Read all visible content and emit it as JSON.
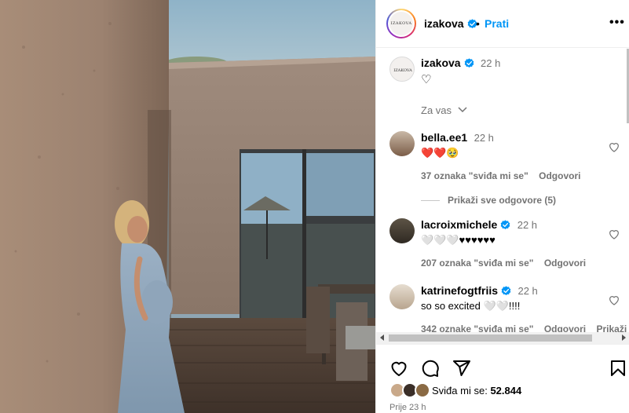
{
  "header": {
    "username": "izakova",
    "avatar_text": "IZAKOVA",
    "follow_label": "Prati",
    "more_label": "•••"
  },
  "caption": {
    "username": "izakova",
    "time": "22 h",
    "text": "♡"
  },
  "for_you_label": "Za vas",
  "comments": [
    {
      "username": "bella.ee1",
      "time": "22 h",
      "text": "❤️❤️🥹",
      "likes": "37 oznaka \"sviđa mi se\"",
      "reply": "Odgovori",
      "verified": false
    },
    {
      "username": "lacroixmichele",
      "time": "22 h",
      "text": "🤍🤍🤍♥♥♥♥♥♥",
      "likes": "207 oznaka \"sviđa mi se\"",
      "reply": "Odgovori",
      "verified": true
    },
    {
      "username": "katrinefogtfriis",
      "time": "22 h",
      "text": "so so excited 🤍🤍!!!!",
      "likes": "342 oznake \"sviđa mi se\"",
      "reply": "Odgovori",
      "extra": "Prikaži pr",
      "verified": true
    }
  ],
  "view_replies": "Prikaži sve odgovore (5)",
  "actions": {
    "likes_prefix": "Sviđa mi se:",
    "likes_count": "52.844",
    "posted": "Prije 23 h"
  },
  "colors": {
    "link": "#0095f6",
    "verified": "#0095f6",
    "muted": "#737373",
    "heart": "#ed4956"
  },
  "icons": [
    "verified-badge-icon",
    "heart-icon",
    "comment-icon",
    "share-icon",
    "bookmark-icon",
    "chevron-down-icon",
    "more-icon"
  ]
}
